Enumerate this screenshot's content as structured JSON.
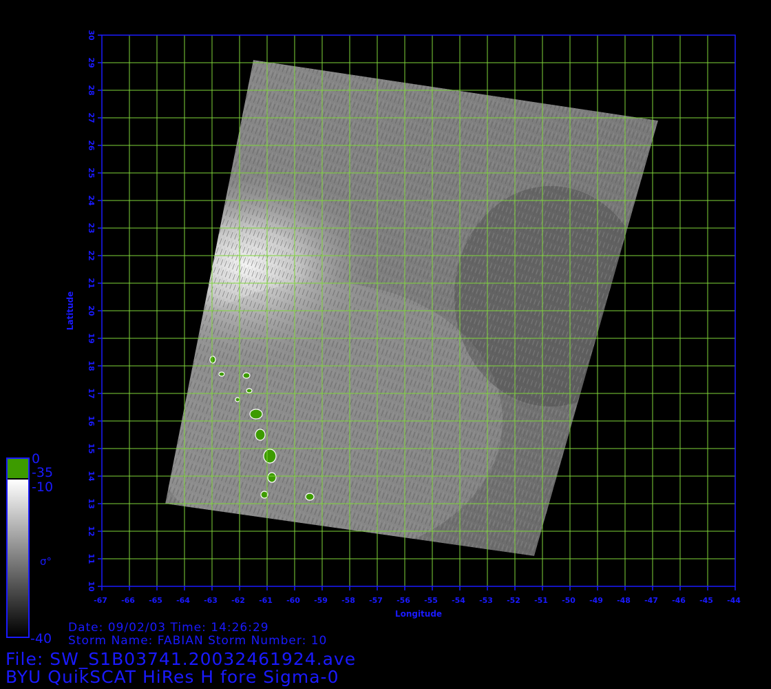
{
  "map": {
    "axes": {
      "x_label": "Longitude",
      "y_label": "Latitude",
      "lon_range": [
        -67,
        -44
      ],
      "lat_range": [
        10,
        30
      ],
      "x_ticks": [
        "-67",
        "-66",
        "-65",
        "-64",
        "-63",
        "-62",
        "-61",
        "-60",
        "-59",
        "-58",
        "-57",
        "-56",
        "-55",
        "-54",
        "-53",
        "-52",
        "-51",
        "-50",
        "-49",
        "-48",
        "-47",
        "-46",
        "-45",
        "-44"
      ],
      "y_ticks": [
        "10",
        "11",
        "12",
        "13",
        "14",
        "15",
        "16",
        "17",
        "18",
        "19",
        "20",
        "21",
        "22",
        "23",
        "24",
        "25",
        "26",
        "27",
        "28",
        "29",
        "30"
      ],
      "grid": true,
      "grid_color": "#7fd63a",
      "axis_color": "#1a1aff"
    },
    "swath_corners_lonlat": [
      [
        -61.5,
        29.1
      ],
      [
        -46.8,
        26.9
      ],
      [
        -51.3,
        11.1
      ],
      [
        -64.7,
        13.0
      ]
    ]
  },
  "colorbar": {
    "top_labels": [
      "0",
      "-35"
    ],
    "upper_label": "-10",
    "symbol": "σ°",
    "bottom_label": "-40",
    "land_color": "#3d9b00",
    "colors": {
      "white": "#ffffff",
      "black": "#000000"
    }
  },
  "info": {
    "date_line": "Date:  09/02/03   Time:  14:26:29",
    "storm_line": "Storm  Name:  FABIAN    Storm  Number:  10",
    "file_line": "File:  SW_S1B03741.20032461924.ave",
    "product_line": "BYU  QuikSCAT  HiRes  H  fore  Sigma-0"
  }
}
